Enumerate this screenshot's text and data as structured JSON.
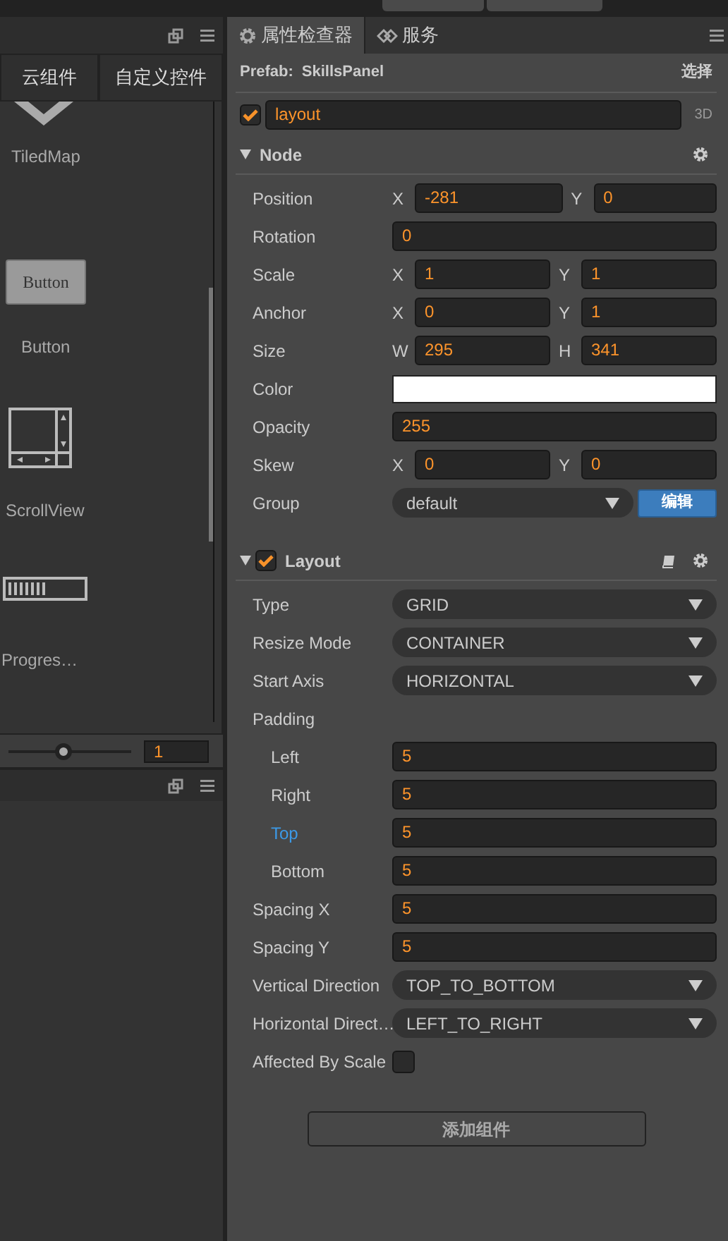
{
  "left_panel": {
    "tabs": [
      {
        "label": "云组件",
        "selected": false
      },
      {
        "label": "自定义控件",
        "selected": false
      }
    ],
    "items": [
      {
        "kind": "tiledmap",
        "label": "TiledMap"
      },
      {
        "kind": "button",
        "label": "Button",
        "preview": "Button"
      },
      {
        "kind": "scrollview",
        "label": "ScrollView"
      },
      {
        "kind": "progress",
        "label": "Progres…"
      }
    ],
    "zoom": {
      "level": 0.45,
      "value": "1"
    }
  },
  "inspector": {
    "tabs": [
      {
        "kind": "gear",
        "label": "属性检查器",
        "selected": true
      },
      {
        "kind": "service",
        "label": "服务",
        "selected": false
      }
    ],
    "prefab": {
      "label": "Prefab:",
      "name": "SkillsPanel",
      "action": "选择"
    },
    "node_name": {
      "enabled": true,
      "value": "layout",
      "mode": "3D"
    },
    "sections": [
      {
        "title": "Node",
        "expanded": true,
        "toggle": false,
        "docs": false,
        "rows": [
          {
            "kind": "pair",
            "label": "Position",
            "fields": [
              {
                "axis": "X",
                "value": "-281"
              },
              {
                "axis": "Y",
                "value": "0"
              }
            ]
          },
          {
            "kind": "number",
            "label": "Rotation",
            "value": "0"
          },
          {
            "kind": "pair",
            "label": "Scale",
            "fields": [
              {
                "axis": "X",
                "value": "1"
              },
              {
                "axis": "Y",
                "value": "1"
              }
            ]
          },
          {
            "kind": "pair",
            "label": "Anchor",
            "fields": [
              {
                "axis": "X",
                "value": "0"
              },
              {
                "axis": "Y",
                "value": "1"
              }
            ]
          },
          {
            "kind": "pair",
            "label": "Size",
            "fields": [
              {
                "axis": "W",
                "value": "295"
              },
              {
                "axis": "H",
                "value": "341"
              }
            ]
          },
          {
            "kind": "color",
            "label": "Color",
            "color": "#ffffff"
          },
          {
            "kind": "number",
            "label": "Opacity",
            "value": "255"
          },
          {
            "kind": "pair",
            "label": "Skew",
            "fields": [
              {
                "axis": "X",
                "value": "0"
              },
              {
                "axis": "Y",
                "value": "0"
              }
            ]
          },
          {
            "kind": "select",
            "label": "Group",
            "value": "default",
            "button": "编辑"
          }
        ]
      },
      {
        "title": "Layout",
        "expanded": true,
        "toggle": true,
        "enabled": true,
        "docs": true,
        "rows": [
          {
            "kind": "select",
            "label": "Type",
            "value": "GRID"
          },
          {
            "kind": "select",
            "label": "Resize Mode",
            "value": "CONTAINER"
          },
          {
            "kind": "select",
            "label": "Start Axis",
            "value": "HORIZONTAL"
          },
          {
            "kind": "group",
            "label": "Padding",
            "children": [
              {
                "kind": "number",
                "label": "Left",
                "value": "5",
                "focused": false
              },
              {
                "kind": "number",
                "label": "Right",
                "value": "5",
                "focused": false
              },
              {
                "kind": "number",
                "label": "Top",
                "value": "5",
                "focused": true
              },
              {
                "kind": "number",
                "label": "Bottom",
                "value": "5",
                "focused": false
              }
            ]
          },
          {
            "kind": "number",
            "label": "Spacing X",
            "value": "5"
          },
          {
            "kind": "number",
            "label": "Spacing Y",
            "value": "5"
          },
          {
            "kind": "select",
            "label": "Vertical Direction",
            "value": "TOP_TO_BOTTOM"
          },
          {
            "kind": "select",
            "label": "Horizontal Direct…",
            "value": "LEFT_TO_RIGHT"
          },
          {
            "kind": "checkbox",
            "label": "Affected By Scale",
            "checked": false
          }
        ]
      }
    ],
    "add_button": "添加组件"
  }
}
